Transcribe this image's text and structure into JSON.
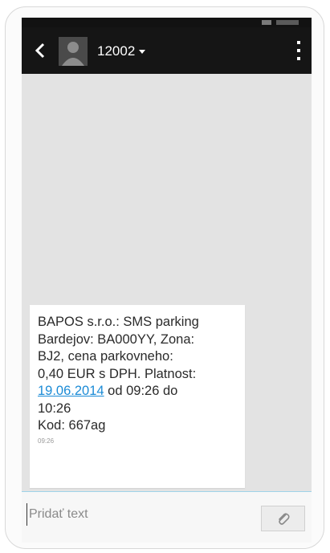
{
  "header": {
    "contact_name": "12002",
    "icons": {
      "back": "back-arrow-icon",
      "avatar": "avatar-placeholder",
      "dropdown": "chevron-down-icon",
      "overflow": "more-vertical-icon"
    }
  },
  "conversation": {
    "messages": [
      {
        "text_before_link": "BAPOS s.r.o.: SMS parking\nBardejov: BA000YY, Zona:\nBJ2, cena parkovneho:\n0,40 EUR s DPH. Platnost:\n",
        "link_text": "19.06.2014",
        "text_after_link": " od 09:26 do\n10:26\nKod: 667ag",
        "time": "09:26"
      }
    ]
  },
  "composer": {
    "placeholder": "Pridať text",
    "value": "",
    "attach_icon": "paperclip-icon"
  },
  "colors": {
    "action_bar": "#151515",
    "background": "#e3e3e3",
    "link": "#1b8bd6",
    "composer_border": "#9fd3e8"
  }
}
